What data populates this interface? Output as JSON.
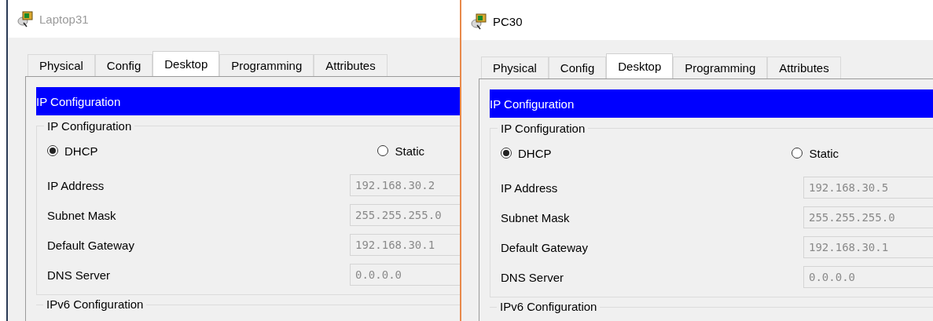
{
  "windows": [
    {
      "title": "Laptop31",
      "active": false,
      "tabs": [
        {
          "label": "Physical",
          "selected": false
        },
        {
          "label": "Config",
          "selected": false
        },
        {
          "label": "Desktop",
          "selected": true
        },
        {
          "label": "Programming",
          "selected": false
        },
        {
          "label": "Attributes",
          "selected": false
        }
      ],
      "section_header": "IP Configuration",
      "group_title": "IP Configuration",
      "radios": [
        {
          "label": "DHCP",
          "selected": true
        },
        {
          "label": "Static",
          "selected": false
        }
      ],
      "fields": [
        {
          "label": "IP Address",
          "value": "192.168.30.2",
          "disabled": true
        },
        {
          "label": "Subnet Mask",
          "value": "255.255.255.0",
          "disabled": true
        },
        {
          "label": "Default Gateway",
          "value": "192.168.30.1",
          "disabled": true
        },
        {
          "label": "DNS Server",
          "value": "0.0.0.0",
          "disabled": true
        }
      ],
      "next_group_title": "IPv6 Configuration"
    },
    {
      "title": "PC30",
      "active": true,
      "tabs": [
        {
          "label": "Physical",
          "selected": false
        },
        {
          "label": "Config",
          "selected": false
        },
        {
          "label": "Desktop",
          "selected": true
        },
        {
          "label": "Programming",
          "selected": false
        },
        {
          "label": "Attributes",
          "selected": false
        }
      ],
      "section_header": "IP Configuration",
      "group_title": "IP Configuration",
      "radios": [
        {
          "label": "DHCP",
          "selected": true
        },
        {
          "label": "Static",
          "selected": false
        }
      ],
      "fields": [
        {
          "label": "IP Address",
          "value": "192.168.30.5",
          "disabled": true
        },
        {
          "label": "Subnet Mask",
          "value": "255.255.255.0",
          "disabled": true
        },
        {
          "label": "Default Gateway",
          "value": "192.168.30.1",
          "disabled": true
        },
        {
          "label": "DNS Server",
          "value": "0.0.0.0",
          "disabled": true
        }
      ],
      "next_group_title": "IPv6 Configuration"
    }
  ]
}
